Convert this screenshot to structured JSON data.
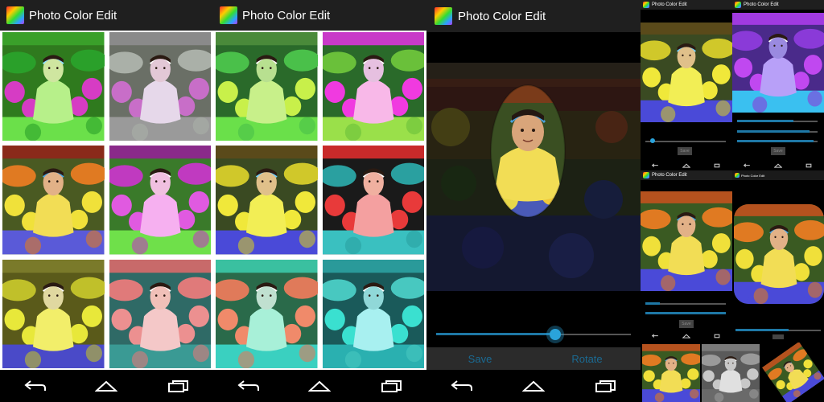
{
  "app": {
    "title": "Photo Color Edit"
  },
  "screen1": {
    "filters": [
      "green",
      "purple-gray",
      "warm",
      "magenta-green",
      "yellow",
      "rose-teal",
      "lime",
      "magenta-lime",
      "yellow-blue",
      "red-cyan",
      "cyan-salmon",
      "cyan-tint"
    ]
  },
  "screen2": {
    "filters": [
      "warm",
      "magenta-green",
      "lime",
      "magenta-lime",
      "cyan-salmon",
      "cyan-tint"
    ]
  },
  "screen3": {
    "slider_value": 0.61,
    "save_label": "Save",
    "rotate_label": "Rotate"
  },
  "mini": {
    "title_a": "Photo Color Edit",
    "title_b": "Photo Color Edit",
    "title_c": "Photo Color Edit",
    "title_d": "Photo Color Edit",
    "button_label": "Save"
  },
  "icons": {
    "back": "back-icon",
    "home": "home-icon",
    "recents": "recents-icon"
  },
  "colors": {
    "accent": "#2aa3db",
    "button_text": "#1b6a92",
    "actionbar": "#1f1f1f"
  }
}
